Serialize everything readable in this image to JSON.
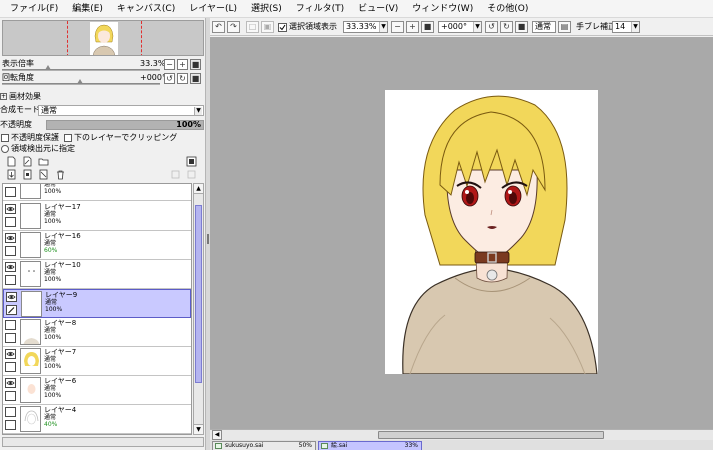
{
  "menu": [
    "ファイル(F)",
    "編集(E)",
    "キャンバス(C)",
    "レイヤー(L)",
    "選択(S)",
    "フィルタ(T)",
    "ビュー(V)",
    "ウィンドウ(W)",
    "その他(O)"
  ],
  "navigator": {
    "zoom_label": "表示倍率",
    "zoom_value": "33.3%",
    "rotate_label": "回転角度",
    "rotate_value": "+000°"
  },
  "layer_props": {
    "section_title": "画材効果",
    "blend_label": "合成モード",
    "blend_value": "通常",
    "opacity_label": "不透明度",
    "opacity_value": "100%",
    "opacity_fraction": 1.0,
    "protect_opacity": "不透明度保護",
    "clip_below": "下のレイヤーでクリッピング",
    "selection_source": "領域検出元に指定"
  },
  "layers": [
    {
      "name": "",
      "mode": "通常",
      "opacity": "100%",
      "visible": false,
      "selected": false,
      "partial": true
    },
    {
      "name": "レイヤー17",
      "mode": "通常",
      "opacity": "100%",
      "visible": true,
      "selected": false
    },
    {
      "name": "レイヤー16",
      "mode": "通常",
      "opacity": "60%",
      "visible": true,
      "selected": false
    },
    {
      "name": "レイヤー10",
      "mode": "通常",
      "opacity": "100%",
      "visible": true,
      "selected": false
    },
    {
      "name": "レイヤー9",
      "mode": "通常",
      "opacity": "100%",
      "visible": true,
      "selected": true
    },
    {
      "name": "レイヤー8",
      "mode": "通常",
      "opacity": "100%",
      "visible": false,
      "selected": false
    },
    {
      "name": "レイヤー7",
      "mode": "通常",
      "opacity": "100%",
      "visible": true,
      "selected": false
    },
    {
      "name": "レイヤー6",
      "mode": "通常",
      "opacity": "100%",
      "visible": true,
      "selected": false
    },
    {
      "name": "レイヤー4",
      "mode": "通常",
      "opacity": "40%",
      "visible": false,
      "selected": false
    }
  ],
  "toolbar": {
    "selection_display": "選択領域表示",
    "zoom": "33.33%",
    "rotation": "+000°",
    "mode": "通常",
    "stabilizer_label": "手ブレ補正",
    "stabilizer_value": "14"
  },
  "tabs": [
    {
      "name": "sukusuyo.sai",
      "zoom": "50%",
      "active": false
    },
    {
      "name": "絵.sai",
      "zoom": "33%",
      "active": true
    }
  ],
  "colors": {
    "selection": "#c9c9ff",
    "canvas_bg": "#a9a9a9",
    "hair": "#f2d75a",
    "sweater": "#d8c8b0",
    "eyes": "#b01818",
    "collar": "#7a3a20"
  }
}
